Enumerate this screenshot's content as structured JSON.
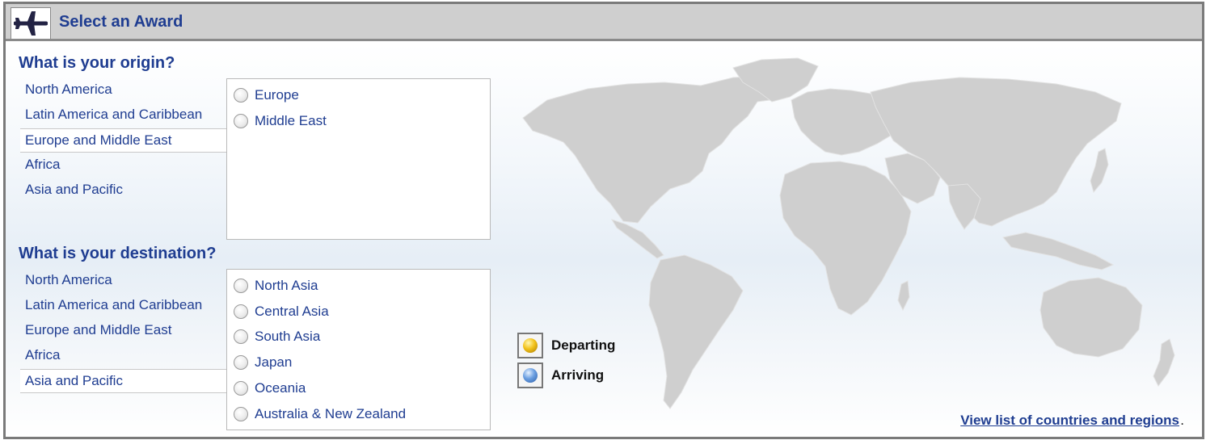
{
  "header": {
    "title": "Select an Award",
    "icon": "airplane-icon"
  },
  "origin": {
    "heading": "What is your origin?",
    "regions": [
      "North America",
      "Latin America and Caribbean",
      "Europe and Middle East",
      "Africa",
      "Asia and Pacific"
    ],
    "selected_region": "Europe and Middle East",
    "options": [
      "Europe",
      "Middle East"
    ]
  },
  "destination": {
    "heading": "What is your destination?",
    "regions": [
      "North America",
      "Latin America and Caribbean",
      "Europe and Middle East",
      "Africa",
      "Asia and Pacific"
    ],
    "selected_region": "Asia and Pacific",
    "options": [
      "North Asia",
      "Central Asia",
      "South Asia",
      "Japan",
      "Oceania",
      "Australia & New Zealand"
    ]
  },
  "legend": {
    "departing": "Departing",
    "arriving": "Arriving"
  },
  "footer": {
    "link_text": "View list of countries and regions",
    "trailing": "."
  },
  "colors": {
    "accent": "#1f3d91",
    "map_land": "#cfcfcf",
    "header_bg": "#cfcfcf"
  }
}
